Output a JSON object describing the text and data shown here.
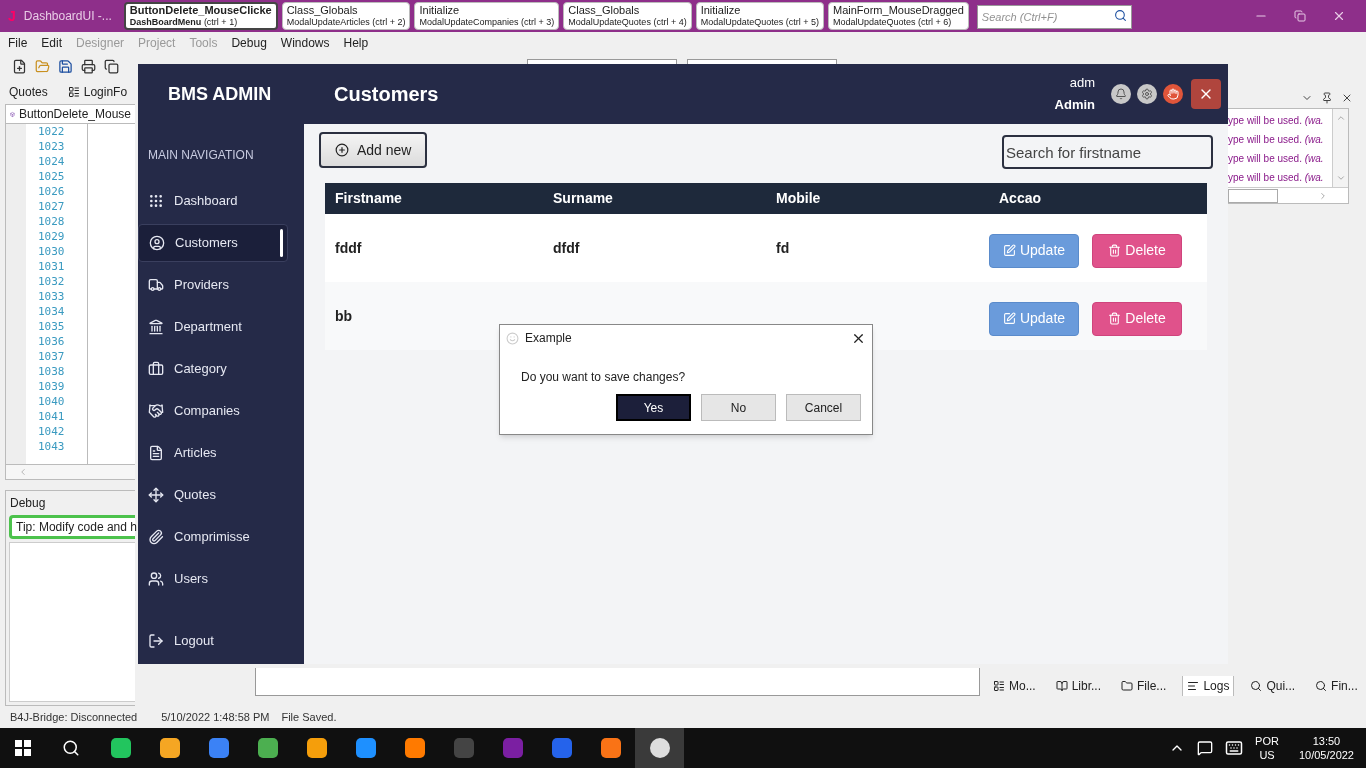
{
  "ide": {
    "logo": "J",
    "app_title": "DashboardUI -...",
    "tabs": [
      {
        "title": "ButtonDelete_MouseClicke",
        "subtitle": "DashBoardMenu",
        "shortcut": "(ctrl + 1)",
        "selected": true
      },
      {
        "title": "Class_Globals",
        "subtitle": "ModalUpdateArticles",
        "shortcut": "(ctrl + 2)",
        "selected": false
      },
      {
        "title": "Initialize",
        "subtitle": "ModalUpdateCompanies",
        "shortcut": "(ctrl + 3)",
        "selected": false
      },
      {
        "title": "Class_Globals",
        "subtitle": "ModalUpdateQuotes",
        "shortcut": "(ctrl + 4)",
        "selected": false
      },
      {
        "title": "Initialize",
        "subtitle": "ModalUpdateQuotes",
        "shortcut": "(ctrl + 5)",
        "selected": false
      },
      {
        "title": "MainForm_MouseDragged",
        "subtitle": "ModalUpdateQuotes",
        "shortcut": "(ctrl + 6)",
        "selected": false
      }
    ],
    "search": {
      "placeholder": "Search (Ctrl+F)"
    },
    "menu": [
      {
        "label": "File",
        "disabled": false
      },
      {
        "label": "Edit",
        "disabled": false
      },
      {
        "label": "Designer",
        "disabled": true
      },
      {
        "label": "Project",
        "disabled": true
      },
      {
        "label": "Tools",
        "disabled": true
      },
      {
        "label": "Debug",
        "disabled": false
      },
      {
        "label": "Windows",
        "disabled": false
      },
      {
        "label": "Help",
        "disabled": false
      }
    ],
    "left_tabs": [
      "Quotes",
      "LoginFo"
    ],
    "file_tab": "ButtonDelete_Mouse",
    "line_numbers": [
      "1022",
      "1023",
      "1024",
      "1025",
      "1026",
      "1027",
      "1028",
      "1029",
      "1030",
      "1031",
      "1032",
      "1033",
      "1034",
      "1035",
      "1036",
      "1037",
      "1038",
      "1039",
      "1040",
      "1041",
      "1042",
      "1043"
    ],
    "debug": {
      "title": "Debug",
      "tip": "Tip: Modify code and h"
    },
    "log_lines": [
      "ype will be used. *(wa.*",
      "ype will be used. *(wa.*",
      "ype will be used. *(wa.*",
      "ype will be used. *(wa.*"
    ],
    "bottom_tabs": [
      {
        "label": "Mo...",
        "selected": false
      },
      {
        "label": "Libr...",
        "selected": false
      },
      {
        "label": "File...",
        "selected": false
      },
      {
        "label": "Logs",
        "selected": true
      },
      {
        "label": "Qui...",
        "selected": false
      },
      {
        "label": "Fin...",
        "selected": false
      }
    ],
    "status_bar": [
      "B4J-Bridge: Disconnected",
      "5/10/2022 1:48:58 PM",
      "File Saved."
    ]
  },
  "app": {
    "brand": "BMS ADMIN",
    "page_title": "Customers",
    "user": {
      "name": "adm",
      "role": "Admin"
    },
    "nav_heading": "MAIN NAVIGATION",
    "nav": [
      {
        "label": "Dashboard",
        "selected": false
      },
      {
        "label": "Customers",
        "selected": true
      },
      {
        "label": "Providers",
        "selected": false
      },
      {
        "label": "Department",
        "selected": false
      },
      {
        "label": "Category",
        "selected": false
      },
      {
        "label": "Companies",
        "selected": false
      },
      {
        "label": "Articles",
        "selected": false
      },
      {
        "label": "Quotes",
        "selected": false
      },
      {
        "label": "Comprimisse",
        "selected": false
      },
      {
        "label": "Users",
        "selected": false
      },
      {
        "label": "Logout",
        "selected": false
      }
    ],
    "add_button": "Add new",
    "search": {
      "placeholder": "Search for firstname"
    },
    "table": {
      "columns": [
        "Firstname",
        "Surname",
        "Mobile",
        "Accao"
      ],
      "rows": [
        {
          "cells": [
            "fddf",
            "dfdf",
            "fd"
          ],
          "actions": [
            {
              "label": "Update",
              "kind": "update"
            },
            {
              "label": "Delete",
              "kind": "delete"
            }
          ]
        },
        {
          "cells": [
            "bb"
          ],
          "actions": [
            {
              "label": "Update",
              "kind": "update"
            },
            {
              "label": "Delete",
              "kind": "delete"
            }
          ]
        }
      ]
    }
  },
  "dialog": {
    "title": "Example",
    "message": "Do you want to save changes?",
    "buttons": [
      {
        "label": "Yes",
        "selected": true
      },
      {
        "label": "No",
        "selected": false
      },
      {
        "label": "Cancel",
        "selected": false
      }
    ]
  },
  "taskbar": {
    "language": "POR",
    "region": "US",
    "time": "13:50",
    "date": "10/05/2022"
  }
}
